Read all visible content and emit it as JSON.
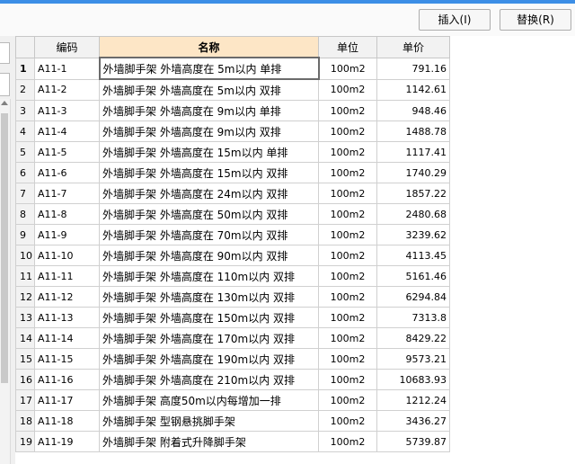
{
  "toolbar": {
    "insert_label": "插入(I)",
    "replace_label": "替换(R)"
  },
  "table": {
    "headers": {
      "code": "编码",
      "name": "名称",
      "unit": "单位",
      "price": "单价"
    },
    "rows": [
      {
        "num": "1",
        "code": "A11-1",
        "name": "外墙脚手架 外墙高度在 5m以内 单排",
        "unit": "100m2",
        "price": "791.16"
      },
      {
        "num": "2",
        "code": "A11-2",
        "name": "外墙脚手架 外墙高度在 5m以内 双排",
        "unit": "100m2",
        "price": "1142.61"
      },
      {
        "num": "3",
        "code": "A11-3",
        "name": "外墙脚手架 外墙高度在 9m以内 单排",
        "unit": "100m2",
        "price": "948.46"
      },
      {
        "num": "4",
        "code": "A11-4",
        "name": "外墙脚手架 外墙高度在 9m以内 双排",
        "unit": "100m2",
        "price": "1488.78"
      },
      {
        "num": "5",
        "code": "A11-5",
        "name": "外墙脚手架 外墙高度在 15m以内 单排",
        "unit": "100m2",
        "price": "1117.41"
      },
      {
        "num": "6",
        "code": "A11-6",
        "name": "外墙脚手架 外墙高度在 15m以内 双排",
        "unit": "100m2",
        "price": "1740.29"
      },
      {
        "num": "7",
        "code": "A11-7",
        "name": "外墙脚手架 外墙高度在 24m以内 双排",
        "unit": "100m2",
        "price": "1857.22"
      },
      {
        "num": "8",
        "code": "A11-8",
        "name": "外墙脚手架 外墙高度在 50m以内 双排",
        "unit": "100m2",
        "price": "2480.68"
      },
      {
        "num": "9",
        "code": "A11-9",
        "name": "外墙脚手架 外墙高度在 70m以内 双排",
        "unit": "100m2",
        "price": "3239.62"
      },
      {
        "num": "10",
        "code": "A11-10",
        "name": "外墙脚手架 外墙高度在 90m以内 双排",
        "unit": "100m2",
        "price": "4113.45"
      },
      {
        "num": "11",
        "code": "A11-11",
        "name": "外墙脚手架 外墙高度在 110m以内 双排",
        "unit": "100m2",
        "price": "5161.46"
      },
      {
        "num": "12",
        "code": "A11-12",
        "name": "外墙脚手架 外墙高度在 130m以内 双排",
        "unit": "100m2",
        "price": "6294.84"
      },
      {
        "num": "13",
        "code": "A11-13",
        "name": "外墙脚手架 外墙高度在 150m以内 双排",
        "unit": "100m2",
        "price": "7313.8"
      },
      {
        "num": "14",
        "code": "A11-14",
        "name": "外墙脚手架 外墙高度在 170m以内 双排",
        "unit": "100m2",
        "price": "8429.22"
      },
      {
        "num": "15",
        "code": "A11-15",
        "name": "外墙脚手架 外墙高度在 190m以内 双排",
        "unit": "100m2",
        "price": "9573.21"
      },
      {
        "num": "16",
        "code": "A11-16",
        "name": "外墙脚手架 外墙高度在 210m以内 双排",
        "unit": "100m2",
        "price": "10683.93"
      },
      {
        "num": "17",
        "code": "A11-17",
        "name": "外墙脚手架 高度50m以内每增加一排",
        "unit": "100m2",
        "price": "1212.24"
      },
      {
        "num": "18",
        "code": "A11-18",
        "name": "外墙脚手架 型钢悬挑脚手架",
        "unit": "100m2",
        "price": "3436.27"
      },
      {
        "num": "19",
        "code": "A11-19",
        "name": "外墙脚手架 附着式升降脚手架",
        "unit": "100m2",
        "price": "5739.87"
      }
    ]
  }
}
